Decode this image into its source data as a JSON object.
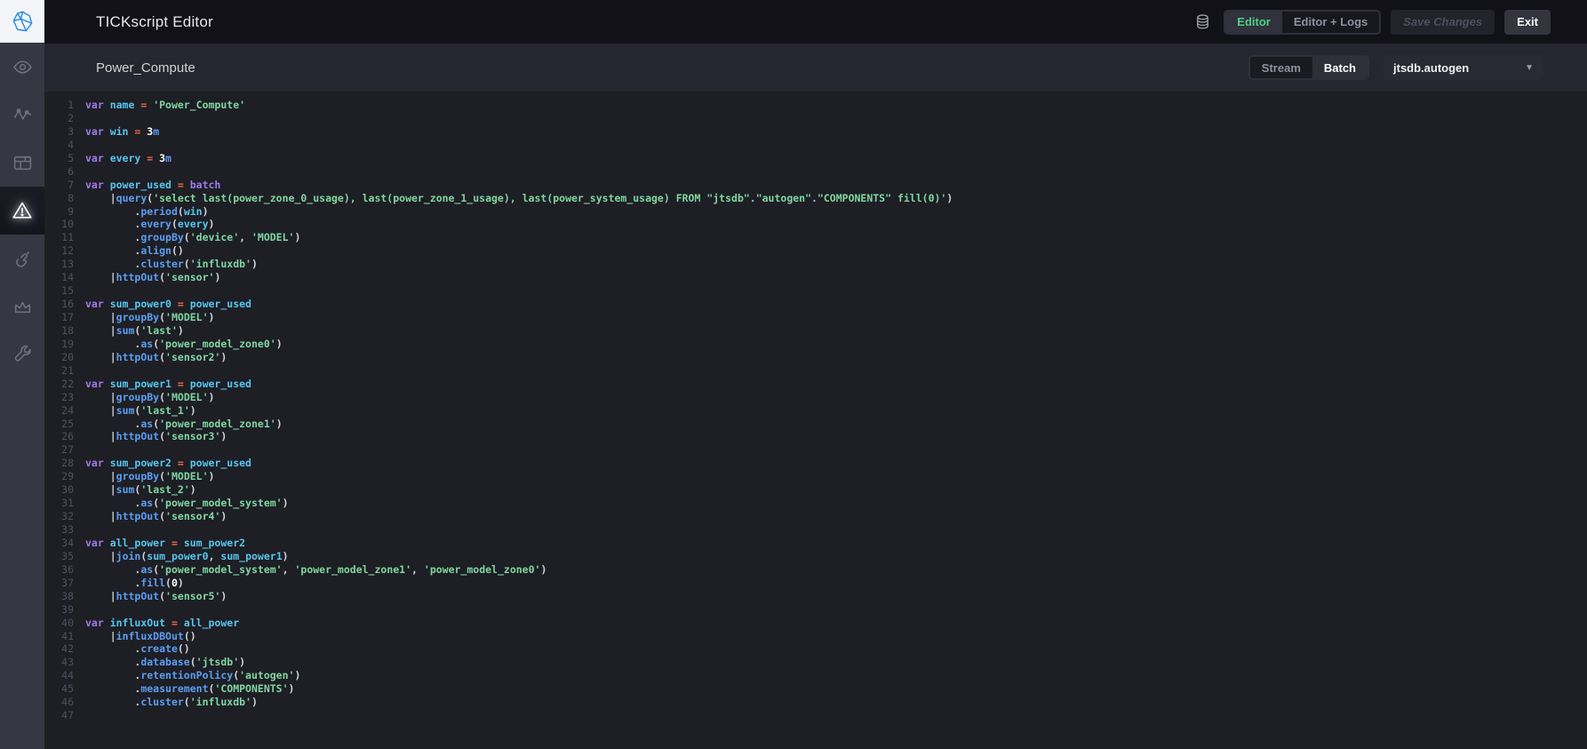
{
  "app": {
    "title": "TICKscript Editor"
  },
  "colors": {
    "brand_blue": "#2e8de8",
    "active_green": "#4ed18a",
    "syntax": {
      "kw": "#9d7ce8",
      "id": "#56c6ee",
      "fn": "#5a9ff2",
      "str": "#7fd6a0",
      "num": "#ffffff",
      "op": "#ea6847",
      "pun": "#d4d5da"
    }
  },
  "sidebar": {
    "logo_icon": "chronograf-logo-icon",
    "items": [
      {
        "icon": "eye-icon",
        "active": false
      },
      {
        "icon": "pulse-graph-icon",
        "active": false
      },
      {
        "icon": "dashboard-grid-icon",
        "active": false
      },
      {
        "icon": "alert-triangle-icon",
        "active": true
      },
      {
        "icon": "hand-gesture-icon",
        "active": false
      },
      {
        "icon": "crown-icon",
        "active": false
      },
      {
        "icon": "wrench-icon",
        "active": false
      }
    ]
  },
  "header": {
    "title": "TICKscript Editor",
    "db_icon": "database-icon",
    "view_toggle": [
      {
        "label": "Editor",
        "active": true
      },
      {
        "label": "Editor + Logs",
        "active": false
      }
    ],
    "save_button": {
      "label": "Save Changes",
      "disabled": true
    },
    "exit_button": {
      "label": "Exit"
    }
  },
  "subheader": {
    "title": "Power_Compute",
    "mode_toggle": [
      {
        "label": "Stream",
        "active": false
      },
      {
        "label": "Batch",
        "active": true
      }
    ],
    "database_dropdown": {
      "value": "jtsdb.autogen",
      "icon": "chevron-down-icon"
    }
  },
  "editor": {
    "total_lines": 47,
    "lines": [
      {
        "n": 1,
        "tokens": [
          [
            "var ",
            "kw"
          ],
          [
            "name ",
            "id"
          ],
          [
            "= ",
            "op"
          ],
          [
            "'Power_Compute'",
            "str"
          ]
        ]
      },
      {
        "n": 2,
        "tokens": []
      },
      {
        "n": 3,
        "tokens": [
          [
            "var ",
            "kw"
          ],
          [
            "win ",
            "id"
          ],
          [
            "= ",
            "op"
          ],
          [
            "3",
            "num"
          ],
          [
            "m",
            "fn"
          ]
        ]
      },
      {
        "n": 4,
        "tokens": []
      },
      {
        "n": 5,
        "tokens": [
          [
            "var ",
            "kw"
          ],
          [
            "every ",
            "id"
          ],
          [
            "= ",
            "op"
          ],
          [
            "3",
            "num"
          ],
          [
            "m",
            "fn"
          ]
        ]
      },
      {
        "n": 6,
        "tokens": []
      },
      {
        "n": 7,
        "tokens": [
          [
            "var ",
            "kw"
          ],
          [
            "power_used ",
            "id"
          ],
          [
            "= ",
            "op"
          ],
          [
            "batch",
            "kw"
          ]
        ]
      },
      {
        "n": 8,
        "tokens": [
          [
            "    "
          ],
          [
            "|",
            "pun"
          ],
          [
            "query",
            "fn"
          ],
          [
            "(",
            "pun"
          ],
          [
            "'select last(power_zone_0_usage), last(power_zone_1_usage), last(power_system_usage) FROM \"jtsdb\".\"autogen\".\"COMPONENTS\" fill(0)'",
            "str"
          ],
          [
            ")",
            "pun"
          ]
        ]
      },
      {
        "n": 9,
        "tokens": [
          [
            "        "
          ],
          [
            ".",
            "pun"
          ],
          [
            "period",
            "fn"
          ],
          [
            "(",
            "pun"
          ],
          [
            "win",
            "id"
          ],
          [
            ")",
            "pun"
          ]
        ]
      },
      {
        "n": 10,
        "tokens": [
          [
            "        "
          ],
          [
            ".",
            "pun"
          ],
          [
            "every",
            "fn"
          ],
          [
            "(",
            "pun"
          ],
          [
            "every",
            "id"
          ],
          [
            ")",
            "pun"
          ]
        ]
      },
      {
        "n": 11,
        "tokens": [
          [
            "        "
          ],
          [
            ".",
            "pun"
          ],
          [
            "groupBy",
            "fn"
          ],
          [
            "(",
            "pun"
          ],
          [
            "'device'",
            "str"
          ],
          [
            ", ",
            "pun"
          ],
          [
            "'MODEL'",
            "str"
          ],
          [
            ")",
            "pun"
          ]
        ]
      },
      {
        "n": 12,
        "tokens": [
          [
            "        "
          ],
          [
            ".",
            "pun"
          ],
          [
            "align",
            "fn"
          ],
          [
            "()",
            "pun"
          ]
        ]
      },
      {
        "n": 13,
        "tokens": [
          [
            "        "
          ],
          [
            ".",
            "pun"
          ],
          [
            "cluster",
            "fn"
          ],
          [
            "(",
            "pun"
          ],
          [
            "'influxdb'",
            "str"
          ],
          [
            ")",
            "pun"
          ]
        ]
      },
      {
        "n": 14,
        "tokens": [
          [
            "    "
          ],
          [
            "|",
            "pun"
          ],
          [
            "httpOut",
            "fn"
          ],
          [
            "(",
            "pun"
          ],
          [
            "'sensor'",
            "str"
          ],
          [
            ")",
            "pun"
          ]
        ]
      },
      {
        "n": 15,
        "tokens": []
      },
      {
        "n": 16,
        "tokens": [
          [
            "var ",
            "kw"
          ],
          [
            "sum_power0 ",
            "id"
          ],
          [
            "= ",
            "op"
          ],
          [
            "power_used",
            "id"
          ]
        ]
      },
      {
        "n": 17,
        "tokens": [
          [
            "    "
          ],
          [
            "|",
            "pun"
          ],
          [
            "groupBy",
            "fn"
          ],
          [
            "(",
            "pun"
          ],
          [
            "'MODEL'",
            "str"
          ],
          [
            ")",
            "pun"
          ]
        ]
      },
      {
        "n": 18,
        "tokens": [
          [
            "    "
          ],
          [
            "|",
            "pun"
          ],
          [
            "sum",
            "fn"
          ],
          [
            "(",
            "pun"
          ],
          [
            "'last'",
            "str"
          ],
          [
            ")",
            "pun"
          ]
        ]
      },
      {
        "n": 19,
        "tokens": [
          [
            "        "
          ],
          [
            ".",
            "pun"
          ],
          [
            "as",
            "fn"
          ],
          [
            "(",
            "pun"
          ],
          [
            "'power_model_zone0'",
            "str"
          ],
          [
            ")",
            "pun"
          ]
        ]
      },
      {
        "n": 20,
        "tokens": [
          [
            "    "
          ],
          [
            "|",
            "pun"
          ],
          [
            "httpOut",
            "fn"
          ],
          [
            "(",
            "pun"
          ],
          [
            "'sensor2'",
            "str"
          ],
          [
            ")",
            "pun"
          ]
        ]
      },
      {
        "n": 21,
        "tokens": []
      },
      {
        "n": 22,
        "tokens": [
          [
            "var ",
            "kw"
          ],
          [
            "sum_power1 ",
            "id"
          ],
          [
            "= ",
            "op"
          ],
          [
            "power_used",
            "id"
          ]
        ]
      },
      {
        "n": 23,
        "tokens": [
          [
            "    "
          ],
          [
            "|",
            "pun"
          ],
          [
            "groupBy",
            "fn"
          ],
          [
            "(",
            "pun"
          ],
          [
            "'MODEL'",
            "str"
          ],
          [
            ")",
            "pun"
          ]
        ]
      },
      {
        "n": 24,
        "tokens": [
          [
            "    "
          ],
          [
            "|",
            "pun"
          ],
          [
            "sum",
            "fn"
          ],
          [
            "(",
            "pun"
          ],
          [
            "'last_1'",
            "str"
          ],
          [
            ")",
            "pun"
          ]
        ]
      },
      {
        "n": 25,
        "tokens": [
          [
            "        "
          ],
          [
            ".",
            "pun"
          ],
          [
            "as",
            "fn"
          ],
          [
            "(",
            "pun"
          ],
          [
            "'power_model_zone1'",
            "str"
          ],
          [
            ")",
            "pun"
          ]
        ]
      },
      {
        "n": 26,
        "tokens": [
          [
            "    "
          ],
          [
            "|",
            "pun"
          ],
          [
            "httpOut",
            "fn"
          ],
          [
            "(",
            "pun"
          ],
          [
            "'sensor3'",
            "str"
          ],
          [
            ")",
            "pun"
          ]
        ]
      },
      {
        "n": 27,
        "tokens": []
      },
      {
        "n": 28,
        "tokens": [
          [
            "var ",
            "kw"
          ],
          [
            "sum_power2 ",
            "id"
          ],
          [
            "= ",
            "op"
          ],
          [
            "power_used",
            "id"
          ]
        ]
      },
      {
        "n": 29,
        "tokens": [
          [
            "    "
          ],
          [
            "|",
            "pun"
          ],
          [
            "groupBy",
            "fn"
          ],
          [
            "(",
            "pun"
          ],
          [
            "'MODEL'",
            "str"
          ],
          [
            ")",
            "pun"
          ]
        ]
      },
      {
        "n": 30,
        "tokens": [
          [
            "    "
          ],
          [
            "|",
            "pun"
          ],
          [
            "sum",
            "fn"
          ],
          [
            "(",
            "pun"
          ],
          [
            "'last_2'",
            "str"
          ],
          [
            ")",
            "pun"
          ]
        ]
      },
      {
        "n": 31,
        "tokens": [
          [
            "        "
          ],
          [
            ".",
            "pun"
          ],
          [
            "as",
            "fn"
          ],
          [
            "(",
            "pun"
          ],
          [
            "'power_model_system'",
            "str"
          ],
          [
            ")",
            "pun"
          ]
        ]
      },
      {
        "n": 32,
        "tokens": [
          [
            "    "
          ],
          [
            "|",
            "pun"
          ],
          [
            "httpOut",
            "fn"
          ],
          [
            "(",
            "pun"
          ],
          [
            "'sensor4'",
            "str"
          ],
          [
            ")",
            "pun"
          ]
        ]
      },
      {
        "n": 33,
        "tokens": []
      },
      {
        "n": 34,
        "tokens": [
          [
            "var ",
            "kw"
          ],
          [
            "all_power ",
            "id"
          ],
          [
            "= ",
            "op"
          ],
          [
            "sum_power2",
            "id"
          ]
        ]
      },
      {
        "n": 35,
        "tokens": [
          [
            "    "
          ],
          [
            "|",
            "pun"
          ],
          [
            "join",
            "fn"
          ],
          [
            "(",
            "pun"
          ],
          [
            "sum_power0",
            "id"
          ],
          [
            ", ",
            "pun"
          ],
          [
            "sum_power1",
            "id"
          ],
          [
            ")",
            "pun"
          ]
        ]
      },
      {
        "n": 36,
        "tokens": [
          [
            "        "
          ],
          [
            ".",
            "pun"
          ],
          [
            "as",
            "fn"
          ],
          [
            "(",
            "pun"
          ],
          [
            "'power_model_system'",
            "str"
          ],
          [
            ", ",
            "pun"
          ],
          [
            "'power_model_zone1'",
            "str"
          ],
          [
            ", ",
            "pun"
          ],
          [
            "'power_model_zone0'",
            "str"
          ],
          [
            ")",
            "pun"
          ]
        ]
      },
      {
        "n": 37,
        "tokens": [
          [
            "        "
          ],
          [
            ".",
            "pun"
          ],
          [
            "fill",
            "fn"
          ],
          [
            "(",
            "pun"
          ],
          [
            "0",
            "num"
          ],
          [
            ")",
            "pun"
          ]
        ]
      },
      {
        "n": 38,
        "tokens": [
          [
            "    "
          ],
          [
            "|",
            "pun"
          ],
          [
            "httpOut",
            "fn"
          ],
          [
            "(",
            "pun"
          ],
          [
            "'sensor5'",
            "str"
          ],
          [
            ")",
            "pun"
          ]
        ]
      },
      {
        "n": 39,
        "tokens": []
      },
      {
        "n": 40,
        "tokens": [
          [
            "var ",
            "kw"
          ],
          [
            "influxOut ",
            "id"
          ],
          [
            "= ",
            "op"
          ],
          [
            "all_power",
            "id"
          ]
        ]
      },
      {
        "n": 41,
        "tokens": [
          [
            "    "
          ],
          [
            "|",
            "pun"
          ],
          [
            "influxDBOut",
            "fn"
          ],
          [
            "()",
            "pun"
          ]
        ]
      },
      {
        "n": 42,
        "tokens": [
          [
            "        "
          ],
          [
            ".",
            "pun"
          ],
          [
            "create",
            "fn"
          ],
          [
            "()",
            "pun"
          ]
        ]
      },
      {
        "n": 43,
        "tokens": [
          [
            "        "
          ],
          [
            ".",
            "pun"
          ],
          [
            "database",
            "fn"
          ],
          [
            "(",
            "pun"
          ],
          [
            "'jtsdb'",
            "str"
          ],
          [
            ")",
            "pun"
          ]
        ]
      },
      {
        "n": 44,
        "tokens": [
          [
            "        "
          ],
          [
            ".",
            "pun"
          ],
          [
            "retentionPolicy",
            "fn"
          ],
          [
            "(",
            "pun"
          ],
          [
            "'autogen'",
            "str"
          ],
          [
            ")",
            "pun"
          ]
        ]
      },
      {
        "n": 45,
        "tokens": [
          [
            "        "
          ],
          [
            ".",
            "pun"
          ],
          [
            "measurement",
            "fn"
          ],
          [
            "(",
            "pun"
          ],
          [
            "'COMPONENTS'",
            "str"
          ],
          [
            ")",
            "pun"
          ]
        ]
      },
      {
        "n": 46,
        "tokens": [
          [
            "        "
          ],
          [
            ".",
            "pun"
          ],
          [
            "cluster",
            "fn"
          ],
          [
            "(",
            "pun"
          ],
          [
            "'influxdb'",
            "str"
          ],
          [
            ")",
            "pun"
          ]
        ]
      },
      {
        "n": 47,
        "tokens": []
      }
    ]
  }
}
